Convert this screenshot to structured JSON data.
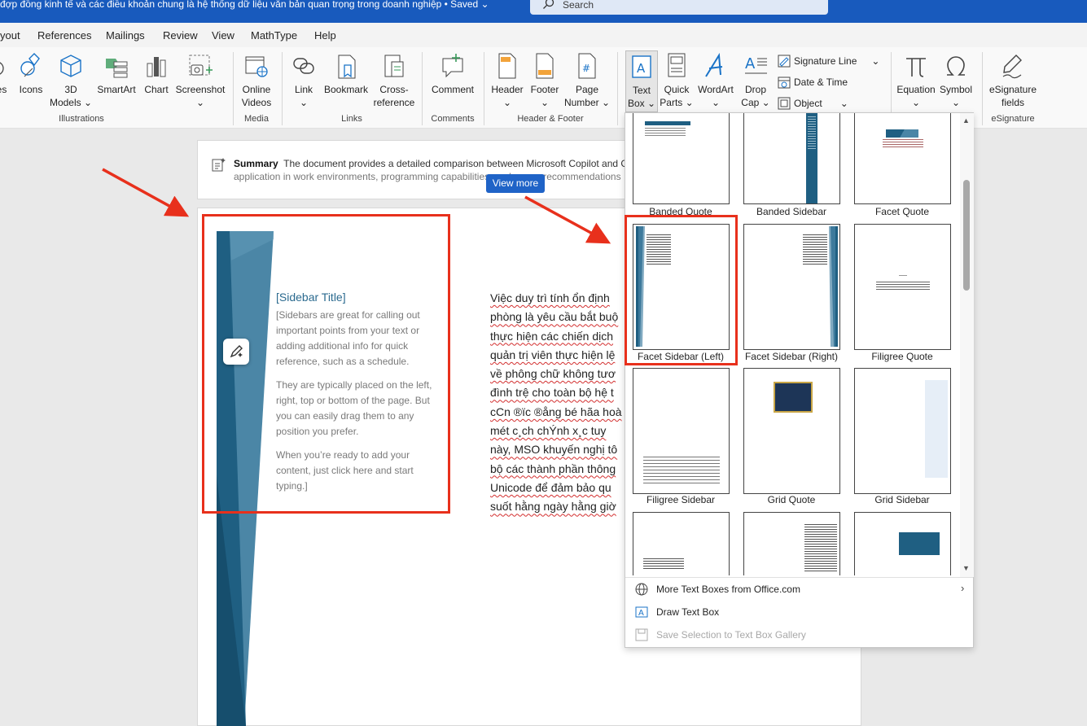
{
  "titlebar": {
    "document_title": "đợp đồng kinh tế và các điều khoản chung là hệ thống dữ liệu văn bản quan trọng trong doanh nghiệp • Saved ⌄",
    "search_placeholder": "Search"
  },
  "menu_tabs": [
    "yout",
    "References",
    "Mailings",
    "Review",
    "View",
    "MathType",
    "Help"
  ],
  "ribbon": {
    "buttons": {
      "pictures_partial": "es",
      "icons": "Icons",
      "models3d": "3D",
      "models3d_2": "Models ⌄",
      "smartart": "SmartArt",
      "chart": "Chart",
      "screenshot": "Screenshot",
      "screenshot_2": "⌄",
      "online_videos": "Online",
      "online_videos_2": "Videos",
      "link": "Link",
      "link_2": "⌄",
      "bookmark": "Bookmark",
      "crossref": "Cross-",
      "crossref_2": "reference",
      "comment": "Comment",
      "header": "Header",
      "header_2": "⌄",
      "footer": "Footer",
      "footer_2": "⌄",
      "page_number": "Page",
      "page_number_2": "Number ⌄",
      "text_box": "Text",
      "text_box_2": "Box ⌄",
      "quick_parts": "Quick",
      "quick_parts_2": "Parts ⌄",
      "wordart": "WordArt",
      "wordart_2": "⌄",
      "drop_cap": "Drop",
      "drop_cap_2": "Cap ⌄",
      "signature_line": "Signature Line",
      "date_time": "Date & Time",
      "object": "Object",
      "equation": "Equation",
      "equation_2": "⌄",
      "symbol": "Symbol",
      "symbol_2": "⌄",
      "esignature": "eSignature",
      "esignature_2": "fields"
    },
    "groups": {
      "illustrations": "Illustrations",
      "media": "Media",
      "links": "Links",
      "comments": "Comments",
      "header_footer": "Header & Footer",
      "esignature": "eSignature"
    }
  },
  "summary": {
    "label": "Summary",
    "line1": "The document provides a detailed comparison between Microsoft Copilot and G",
    "line2": "application in work environments, programming capabilities, and usage recommendations",
    "view_more": "View more"
  },
  "sidebar_box": {
    "title": "[Sidebar Title]",
    "para1": "[Sidebars are great for calling out important points from your text or adding additional info for quick reference, such as a schedule.",
    "para2": "They are typically placed on the left, right, top or bottom of the page. But you can easily drag them to any position you prefer.",
    "para3": "When you’re ready to add your content, just click here and start typing.]"
  },
  "body_text": [
    "Việc duy trì tính ổn định",
    "phòng là yêu cầu bắt buộ",
    "thực hiện các chiến dịch",
    "quản trị viên thực hiện lệ",
    "về phông chữ không tươ",
    "đình trệ cho toàn bộ hệ t",
    "cCn ®ïc ®ång bé hãa hoà",
    "mét c¸ch chÝnh x¸c tuy",
    "này, MSO khuyến nghị tô",
    "bộ các thành phần thông",
    "Unicode để đảm bảo qu",
    "suốt hằng ngày hằng giờ"
  ],
  "gallery": {
    "items": [
      "Banded Quote",
      "Banded Sidebar",
      "Facet Quote",
      "Facet Sidebar (Left)",
      "Facet Sidebar (Right)",
      "Filigree Quote",
      "Filigree Sidebar",
      "Grid Quote",
      "Grid Sidebar"
    ],
    "more_text_boxes": "More Text Boxes from Office.com",
    "draw_text_box": "Draw Text Box",
    "save_selection": "Save Selection to Text Box Gallery"
  },
  "colors": {
    "word_blue": "#185abd",
    "sidebar_blue": "#1f5f82",
    "highlight_red": "#e8301c"
  }
}
